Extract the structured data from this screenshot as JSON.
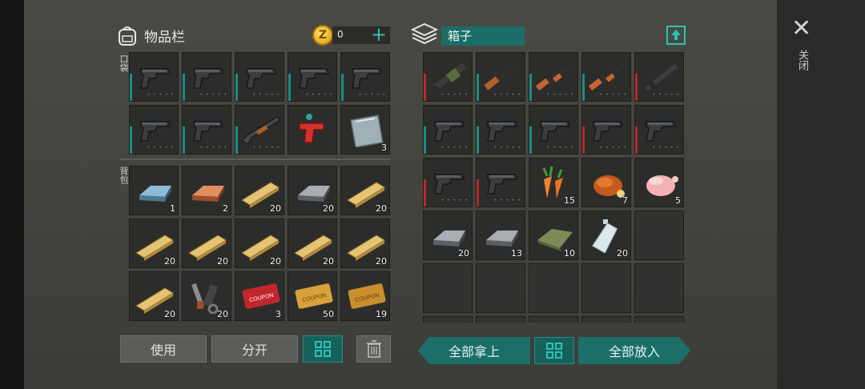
{
  "inventory": {
    "title": "物品栏",
    "coins": "0",
    "pocket_label": "口袋",
    "backpack_label": "背包",
    "pocket": [
      {
        "kind": "pistol",
        "bar": "#1d8c86",
        "dots": "• • • • •"
      },
      {
        "kind": "pistol",
        "bar": "#1d8c86",
        "dots": "• • • • •"
      },
      {
        "kind": "pistol",
        "bar": "#1d8c86",
        "dots": "• • • • •"
      },
      {
        "kind": "pistol",
        "bar": "#1d8c86",
        "dots": "• • • • •"
      },
      {
        "kind": "pistol",
        "bar": "#1d8c86",
        "dots": "• • • • •"
      },
      {
        "kind": "pistol",
        "bar": "#1d8c86",
        "dots": "• • • • •"
      },
      {
        "kind": "pistol",
        "bar": "#1d8c86",
        "dots": "• • • • •"
      },
      {
        "kind": "shotgun",
        "bar": "#1d8c86",
        "dots": "• • • • •"
      },
      {
        "kind": "flaregun",
        "bar": "",
        "dots": ""
      },
      {
        "kind": "plate",
        "qty": "3"
      }
    ],
    "backpack": [
      {
        "kind": "ingot-blue",
        "qty": "1"
      },
      {
        "kind": "ingot-copper",
        "qty": "2"
      },
      {
        "kind": "plank",
        "qty": "20"
      },
      {
        "kind": "ingot-iron",
        "qty": "20"
      },
      {
        "kind": "plank",
        "qty": "20"
      },
      {
        "kind": "plank",
        "qty": "20"
      },
      {
        "kind": "plank",
        "qty": "20"
      },
      {
        "kind": "plank",
        "qty": "20"
      },
      {
        "kind": "plank",
        "qty": "20"
      },
      {
        "kind": "plank",
        "qty": "20"
      },
      {
        "kind": "plank",
        "qty": "20"
      },
      {
        "kind": "parts",
        "qty": "20"
      },
      {
        "kind": "coupon-red",
        "qty": "3"
      },
      {
        "kind": "coupon-gold",
        "qty": "50"
      },
      {
        "kind": "coupon-gold2",
        "qty": "19"
      }
    ]
  },
  "box": {
    "title": "箱子",
    "items": [
      {
        "kind": "launcher",
        "bar": "#b52a2a",
        "dots": "• • • • •"
      },
      {
        "kind": "rifle",
        "bar": "#1d8c86",
        "dots": "• • • • •"
      },
      {
        "kind": "ak",
        "bar": "#1d8c86",
        "dots": "• • • • •"
      },
      {
        "kind": "ak",
        "bar": "#1d8c86",
        "dots": "• • • • •"
      },
      {
        "kind": "m4",
        "bar": "#b52a2a",
        "dots": "• • • • •"
      },
      {
        "kind": "pistol",
        "bar": "#1d8c86",
        "dots": "• • • • •"
      },
      {
        "kind": "pistol",
        "bar": "#1d8c86",
        "dots": "• • • • •"
      },
      {
        "kind": "pistol",
        "bar": "#1d8c86",
        "dots": "• • • • •"
      },
      {
        "kind": "pistol",
        "bar": "#b52a2a",
        "dots": "• • • • •"
      },
      {
        "kind": "pistol",
        "bar": "#b52a2a",
        "dots": "• • • • •"
      },
      {
        "kind": "pistol",
        "bar": "#b52a2a",
        "dots": "• • • • •"
      },
      {
        "kind": "pistol",
        "bar": "#b52a2a",
        "dots": "• • • • •"
      },
      {
        "kind": "carrot",
        "qty": "15"
      },
      {
        "kind": "roast",
        "qty": "7"
      },
      {
        "kind": "chicken",
        "qty": "5"
      },
      {
        "kind": "ingot-iron",
        "qty": "20"
      },
      {
        "kind": "ingot-iron",
        "qty": "13"
      },
      {
        "kind": "cloth",
        "qty": "10"
      },
      {
        "kind": "bottle",
        "qty": "20"
      },
      {
        "kind": "empty"
      },
      {
        "kind": "empty"
      },
      {
        "kind": "empty"
      },
      {
        "kind": "empty"
      },
      {
        "kind": "empty"
      },
      {
        "kind": "empty"
      },
      {
        "kind": "empty"
      },
      {
        "kind": "empty"
      },
      {
        "kind": "empty"
      },
      {
        "kind": "empty"
      },
      {
        "kind": "empty"
      }
    ]
  },
  "buttons": {
    "use": "使用",
    "split": "分开",
    "take_all": "全部拿上",
    "put_all": "全部放入"
  },
  "close_label": "关闭",
  "icons": {
    "backpack": "backpack-icon",
    "coin": "coin-icon",
    "box": "box-icon",
    "sort": "sort-grid-icon",
    "trash": "trash-icon",
    "upload": "upload-icon",
    "close": "close-icon"
  },
  "colors": {
    "accent": "#2bc2b3",
    "teal_bg": "#1b6e68",
    "durability_ok": "#1d8c86",
    "durability_low": "#b52a2a"
  }
}
